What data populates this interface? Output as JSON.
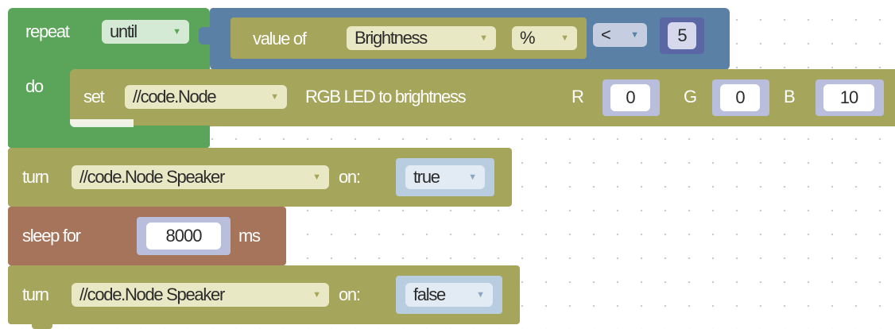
{
  "colors": {
    "loop": "#5ba55b",
    "logic": "#5b80a5",
    "device": "#a5a55b",
    "sleep": "#a5745b",
    "input_bg": "#e9e8c4",
    "field_bg": "#c5cde0"
  },
  "repeat_block": {
    "repeat_label": "repeat",
    "mode": "until",
    "do_label": "do"
  },
  "condition": {
    "value_of_label": "value of",
    "variable": "Brightness",
    "unit": "%",
    "operator": "<",
    "operand": "5"
  },
  "set_led": {
    "set_label": "set",
    "device": "//code.Node",
    "action_label": "RGB LED to brightness",
    "r_label": "R",
    "r_value": "0",
    "g_label": "G",
    "g_value": "0",
    "b_label": "B",
    "b_value": "10"
  },
  "turn_on": {
    "turn_label": "turn",
    "device": "//code.Node Speaker",
    "on_label": "on:",
    "value": "true"
  },
  "sleep": {
    "label": "sleep for",
    "value": "8000",
    "unit": "ms"
  },
  "turn_off": {
    "turn_label": "turn",
    "device": "//code.Node Speaker",
    "on_label": "on:",
    "value": "false"
  },
  "icons": {
    "dropdown": "triangle-down-icon"
  }
}
